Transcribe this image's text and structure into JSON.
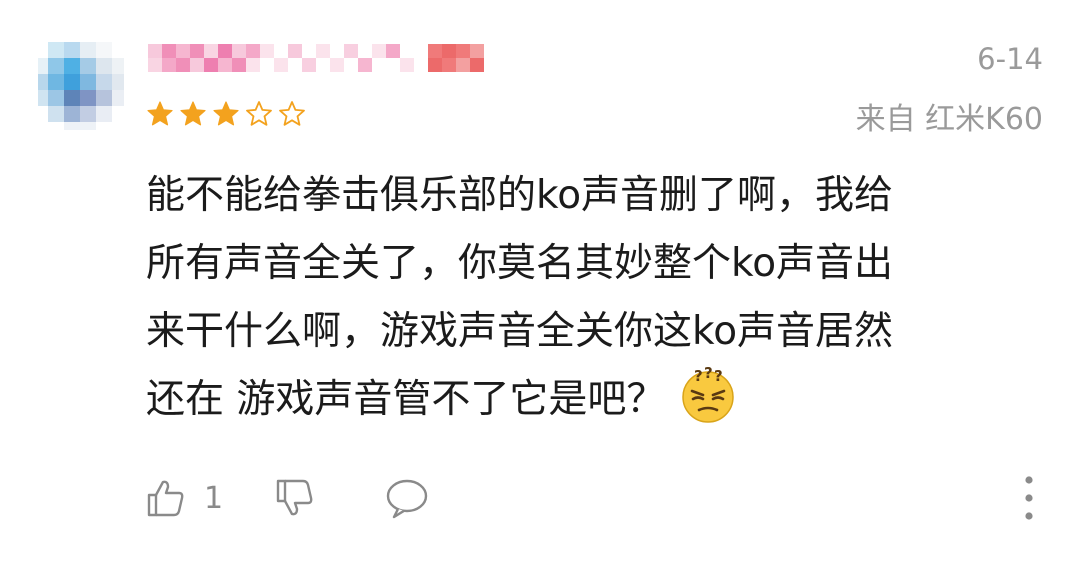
{
  "comment": {
    "date": "6-14",
    "device": "来自 红米K60",
    "rating": {
      "value": 3,
      "max": 5,
      "filled_color": "#f3a21e",
      "empty_color": "#f3a21e"
    },
    "text_lines": [
      "能不能给拳击俱乐部的ko声音删了啊，我给",
      "所有声音全关了，你莫名其妙整个ko声音出",
      "来干什么啊，游戏声音全关你这ko声音居然",
      "还在 游戏声音管不了它是吧？"
    ],
    "emoji": "confused-face-emoji"
  },
  "actions": {
    "like_count": "1",
    "like_icon": "thumbs-up-icon",
    "dislike_icon": "thumbs-down-icon",
    "reply_icon": "comment-bubble-icon",
    "more_icon": "more-vertical-icon",
    "icon_color": "#8a8a8a"
  }
}
